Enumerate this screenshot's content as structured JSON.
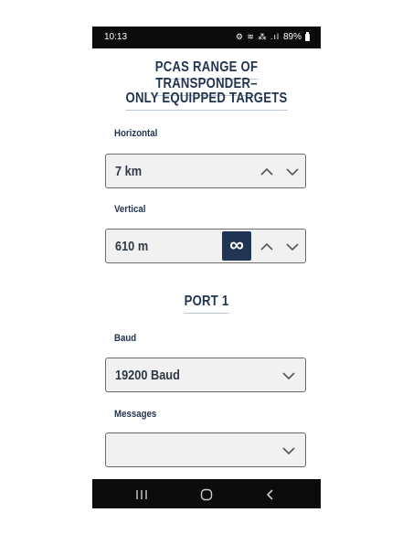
{
  "status_bar": {
    "time": "10:13",
    "icons": "⚙ ≋ ⁂ .ıl",
    "battery": "89%"
  },
  "title_line1": "PCAS RANGE OF TRANSPONDER–",
  "title_line2": "ONLY EQUIPPED TARGETS",
  "horizontal": {
    "label": "Horizontal",
    "value": "7 km"
  },
  "vertical": {
    "label": "Vertical",
    "value": "610 m",
    "infinity_symbol": "∞"
  },
  "port_heading": "PORT 1",
  "baud": {
    "label": "Baud",
    "value": "19200 Baud"
  },
  "messages": {
    "label": "Messages",
    "value": ""
  },
  "colors": {
    "primary": "#223453",
    "field_bg": "#f1f1f1",
    "bar": "#0b0b0b"
  },
  "icons": [
    "chevron-up-icon",
    "chevron-down-icon",
    "recent-apps-icon",
    "home-icon",
    "back-icon"
  ]
}
